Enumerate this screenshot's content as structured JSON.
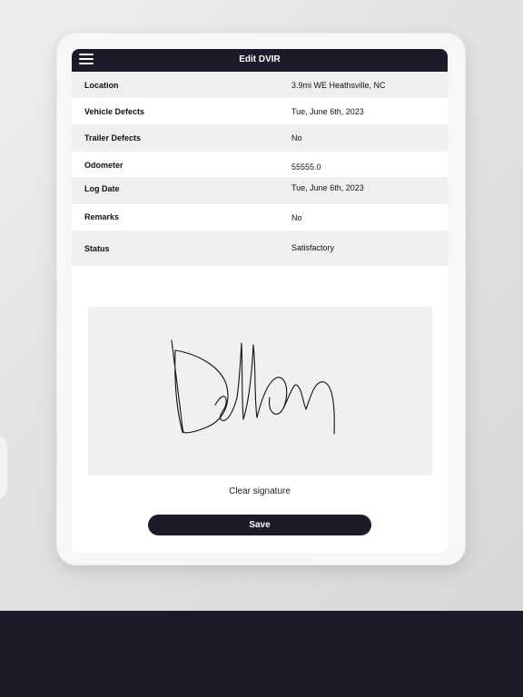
{
  "header": {
    "title": "Edit DVIR",
    "menu_icon": "hamburger-menu-icon"
  },
  "details": [
    {
      "label": "Location",
      "value": "3.9mi WE Heathsville, NC"
    },
    {
      "label": "Vehicle Defects",
      "value": "Tue, June 6th, 2023"
    },
    {
      "label": "Trailer Defects",
      "value": "No"
    },
    {
      "label": "Odometer",
      "value": "55555.0"
    },
    {
      "label": "Log Date",
      "value": "Tue, June 6th, 2023"
    },
    {
      "label": "Remarks",
      "value": "No"
    },
    {
      "label": "Status",
      "value": "Satisfactory"
    }
  ],
  "signature": {
    "clear_label": "Clear signature",
    "signed_text": "Dellon"
  },
  "actions": {
    "save_label": "Save"
  },
  "colors": {
    "header_bg": "#1b1b2a",
    "row_alt_bg": "#efefef",
    "signature_pad_bg": "#f0f0f0"
  }
}
